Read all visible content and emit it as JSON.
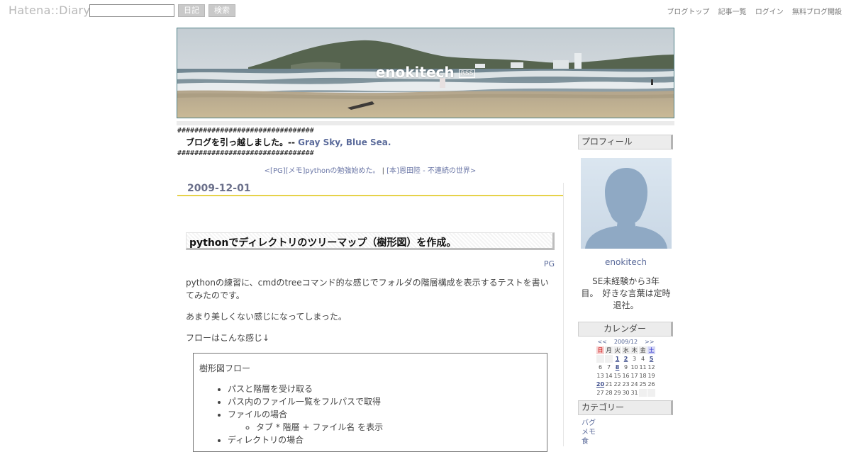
{
  "topbar": {
    "logo": "Hatena::Diary",
    "search_value": "",
    "diary_button": "日記",
    "search_button": "検索",
    "links": [
      "ブログトップ",
      "記事一覧",
      "ログイン",
      "無料ブログ開設"
    ]
  },
  "header": {
    "blog_title": "enokitech",
    "rss": "RSS"
  },
  "notice": {
    "hashes": "################################",
    "text": "ブログを引っ越しました。-- ",
    "link": "Gray Sky, Blue Sea."
  },
  "pager": {
    "prev": "<[PG][メモ]pythonの勉強始めた。",
    "separator": " | ",
    "next": "[本]恩田陸 - 不連続の世界>"
  },
  "entry": {
    "date": "2009-12-01",
    "title": "pythonでディレクトリのツリーマップ（樹形図）を作成。",
    "category": "PG",
    "paragraphs": [
      "pythonの練習に、cmdのtreeコマンド的な感じでフォルダの階層構成を表示するテストを書いてみたのです。",
      "あまり美しくない感じになってしまった。",
      "フローはこんな感じ↓"
    ],
    "flow_box": {
      "title": "樹形図フロー",
      "items": [
        "パスと階層を受け取る",
        "パス内のファイル一覧をフルパスで取得",
        "ファイルの場合"
      ],
      "sub_item": "タブ * 階層 + ファイル名 を表示",
      "item_last": "ディレクトリの場合"
    }
  },
  "sidebar": {
    "profile_title": "プロフィール",
    "profile_name": "enokitech",
    "profile_desc_1": "SE未経験から3年",
    "profile_desc_2": "目。　好きな言葉は定時",
    "profile_desc_3": "退社。",
    "calendar_title": "カレンダー",
    "calendar_prev": "<<",
    "calendar_month": "2009/12",
    "calendar_next": ">>",
    "weekdays": [
      "日",
      "月",
      "火",
      "水",
      "木",
      "金",
      "土"
    ],
    "weeks": [
      [
        "",
        "",
        "1",
        "2",
        "3",
        "4",
        "5"
      ],
      [
        "6",
        "7",
        "8",
        "9",
        "10",
        "11",
        "12"
      ],
      [
        "13",
        "14",
        "15",
        "16",
        "17",
        "18",
        "19"
      ],
      [
        "20",
        "21",
        "22",
        "23",
        "24",
        "25",
        "26"
      ],
      [
        "27",
        "28",
        "29",
        "30",
        "31",
        "",
        ""
      ]
    ],
    "entry_days": [
      "1",
      "2",
      "5",
      "8",
      "20"
    ],
    "category_title": "カテゴリー",
    "categories": [
      "バグ",
      "メモ",
      "食"
    ]
  }
}
